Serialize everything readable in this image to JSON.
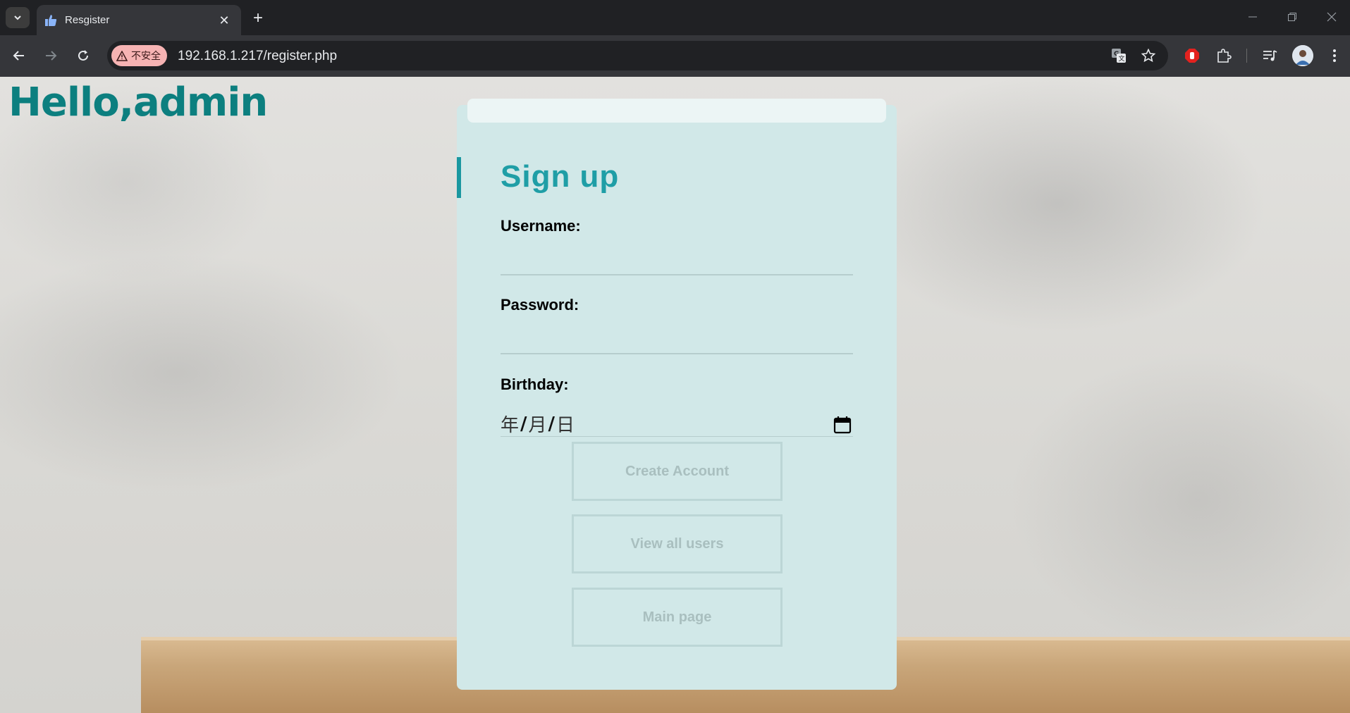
{
  "browser": {
    "tab": {
      "title": "Resgister",
      "favicon": "thumbs-up-icon"
    },
    "security_chip": "不安全",
    "url": "192.168.1.217/register.php",
    "icons": [
      "tab-search-icon",
      "close-icon",
      "new-tab-icon",
      "back-icon",
      "forward-icon",
      "reload-icon",
      "warning-icon",
      "translate-icon",
      "star-icon",
      "adblock-icon",
      "extensions-icon",
      "media-icon",
      "profile-avatar",
      "menu-icon",
      "minimize-icon",
      "maximize-icon",
      "window-close-icon"
    ]
  },
  "page": {
    "greeting": "Hello,admin",
    "form": {
      "title": "Sign up",
      "username_label": "Username:",
      "username_value": "",
      "password_label": "Password:",
      "password_value": "",
      "birthday_label": "Birthday:",
      "birthday_year": "年",
      "birthday_month": "月",
      "birthday_day": "日",
      "date_sep": "/"
    },
    "buttons": {
      "create": "Create Account",
      "view_users": "View all users",
      "main_page": "Main page"
    }
  },
  "colors": {
    "greeting": "#0c7f7f",
    "title": "#1f9ea6",
    "card": "#d1e8e8",
    "button_border": "#bcd6d6",
    "button_text": "#a9bfbf",
    "security_chip": "#f6b3b3"
  }
}
